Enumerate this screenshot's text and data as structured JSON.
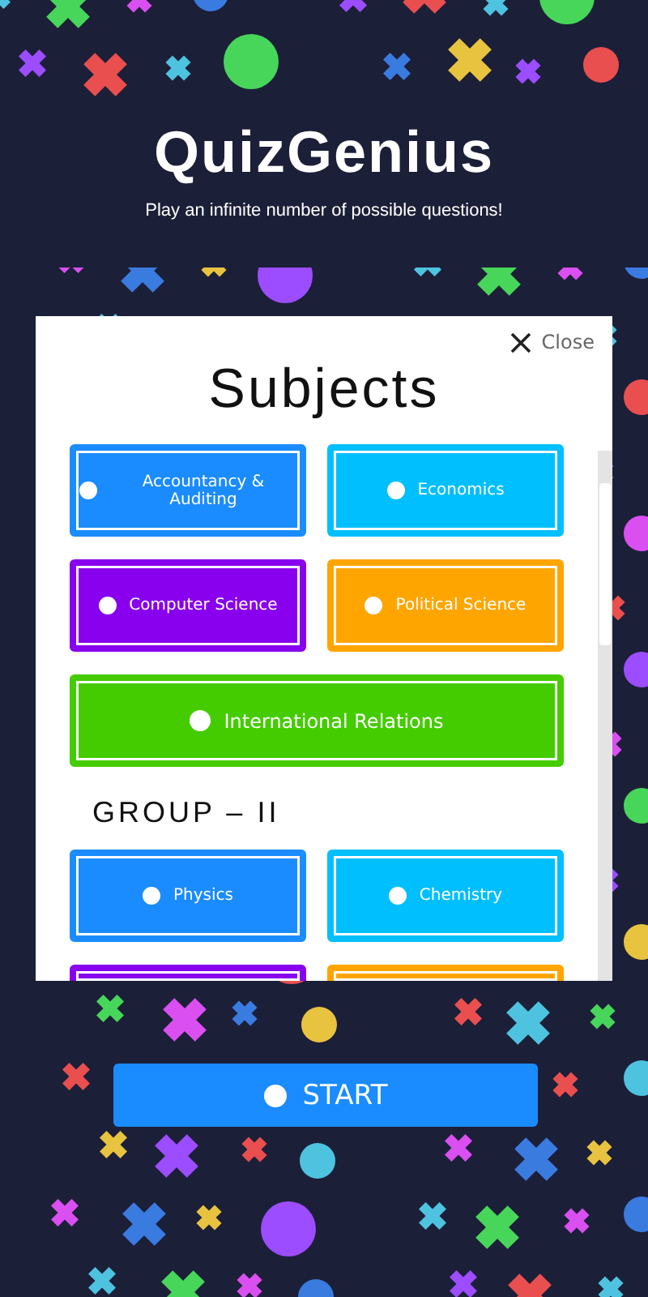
{
  "header": {
    "title": "QuizGenius",
    "subtitle": "Play an infinite number of possible questions!"
  },
  "dialog": {
    "close_label": "Close",
    "title": "Subjects",
    "sections": [
      {
        "subjects": [
          {
            "label": "Accountancy & Auditing",
            "color": "#1a8cff",
            "kind": "half"
          },
          {
            "label": "Economics",
            "color": "#00bfff",
            "kind": "half"
          },
          {
            "label": "Computer Science",
            "color": "#8800ee",
            "kind": "half"
          },
          {
            "label": "Political Science",
            "color": "#ffa500",
            "kind": "half"
          },
          {
            "label": "International Relations",
            "color": "#44cc00",
            "kind": "wide"
          }
        ]
      },
      {
        "heading": "GROUP – II",
        "subjects": [
          {
            "label": "Physics",
            "color": "#1a8cff",
            "kind": "half"
          },
          {
            "label": "Chemistry",
            "color": "#00bfff",
            "kind": "half"
          },
          {
            "color": "#8800ee",
            "kind": "cut"
          },
          {
            "color": "#ffa500",
            "kind": "cut"
          }
        ]
      }
    ]
  },
  "start_button": {
    "label": "START"
  }
}
